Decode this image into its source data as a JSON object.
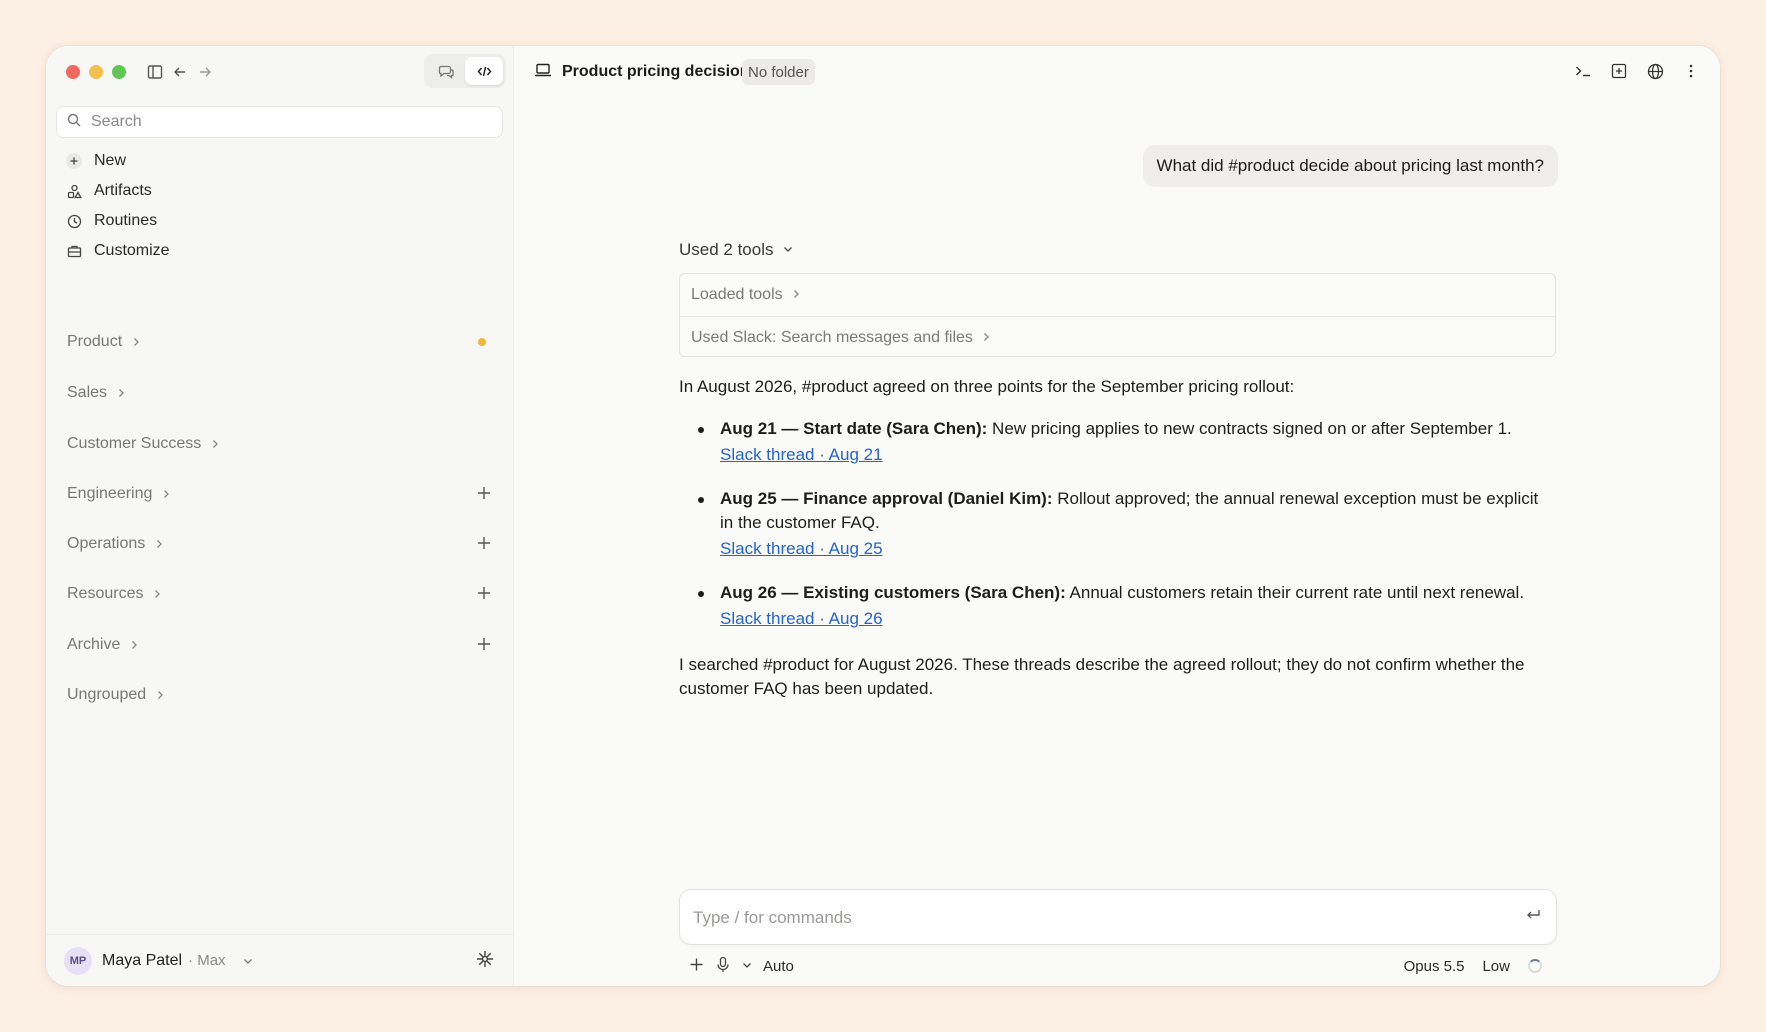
{
  "sidebar": {
    "search_placeholder": "Search",
    "nav": [
      {
        "label": "New",
        "icon": "plus-icon"
      },
      {
        "label": "Artifacts",
        "icon": "artifacts-icon"
      },
      {
        "label": "Routines",
        "icon": "clock-icon"
      },
      {
        "label": "Customize",
        "icon": "briefcase-icon"
      }
    ],
    "groups": [
      {
        "label": "Product",
        "has_dot": true,
        "dot_color": "#f2b53a"
      },
      {
        "label": "Sales"
      },
      {
        "label": "Customer Success"
      },
      {
        "label": "Engineering",
        "has_add": true
      },
      {
        "label": "Operations",
        "has_add": true
      },
      {
        "label": "Resources",
        "has_add": true
      },
      {
        "label": "Archive",
        "has_add": true
      },
      {
        "label": "Ungrouped"
      }
    ],
    "user": {
      "initials": "MP",
      "name": "Maya Patel",
      "plan": "· Max"
    }
  },
  "header": {
    "title": "Product pricing decision",
    "folder": "No folder"
  },
  "conversation": {
    "user_message": "What did #product decide about pricing last month?",
    "tools_summary": "Used 2 tools",
    "tools": [
      {
        "label": "Loaded tools"
      },
      {
        "label": "Used Slack: Search messages and files"
      }
    ],
    "answer_intro": "In August 2026, #product agreed on three points for the September pricing rollout:",
    "points": [
      {
        "bold": "Aug 21 — Start date (Sara Chen):",
        "text": " New pricing applies to new contracts signed on or after September 1.",
        "link": "Slack thread · Aug 21"
      },
      {
        "bold": "Aug 25 — Finance approval (Daniel Kim):",
        "text": " Rollout approved; the annual renewal exception must be explicit in the customer FAQ.",
        "link": "Slack thread · Aug 25"
      },
      {
        "bold": "Aug 26 — Existing customers (Sara Chen):",
        "text": " Annual customers retain their current rate until next renewal.",
        "link": "Slack thread · Aug 26"
      }
    ],
    "closing": "I searched #product for August 2026. These threads describe the agreed rollout; they do not confirm whether the customer FAQ has been updated."
  },
  "composer": {
    "placeholder": "Type / for commands",
    "mode": "Auto",
    "model": "Opus 5.5",
    "effort": "Low"
  },
  "colors": {
    "link": "#2363d1",
    "background": "#fcefe3",
    "accent_dot": "#f2b53a"
  }
}
